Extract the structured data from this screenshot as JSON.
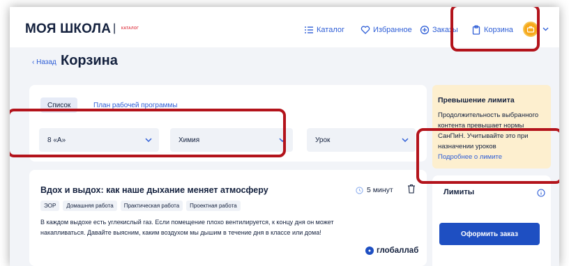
{
  "header": {
    "logo": "МОЯ ШКОЛА",
    "logo_sep": "|",
    "logo_sub": "КАТАЛОГ",
    "nav": {
      "catalog": "Каталог",
      "favorites": "Избранное",
      "orders": "Заказы",
      "cart": "Корзина"
    }
  },
  "page": {
    "back": "‹ Назад",
    "title": "Корзина"
  },
  "filters": {
    "tab_list": "Список",
    "tab_plan": "План рабочей программы",
    "class_value": "8 «А»",
    "subject_value": "Химия",
    "type_value": "Урок"
  },
  "lesson": {
    "title": "Вдох и выдох: как наше дыхание меняет атмосферу",
    "duration": "5 минут",
    "tags": [
      "ЭОР",
      "Домашняя работа",
      "Практическая работа",
      "Проектная работа"
    ],
    "description": "В каждом выдохе есть углекислый газ. Если помещение плохо вентилируется, к концу дня он может накапливаться. Давайте выясним, каким воздухом мы дышим в течение дня в классе или дома!",
    "brand": "глобаллаб"
  },
  "limit_warning": {
    "title": "Превышение лимита",
    "body": "Продолжительность выбранного контента превышает нормы СанПиН. Учитывайте это при назначении уроков",
    "link": "Подробнее о лимите"
  },
  "limits": {
    "title": "Лимиты",
    "order_button": "Оформить заказ"
  },
  "colors": {
    "accent": "#2d5dd6",
    "button": "#1e4fc2",
    "warning_bg": "#fdefcf",
    "highlight": "#b3131b",
    "avatar": "#f7a81b"
  }
}
